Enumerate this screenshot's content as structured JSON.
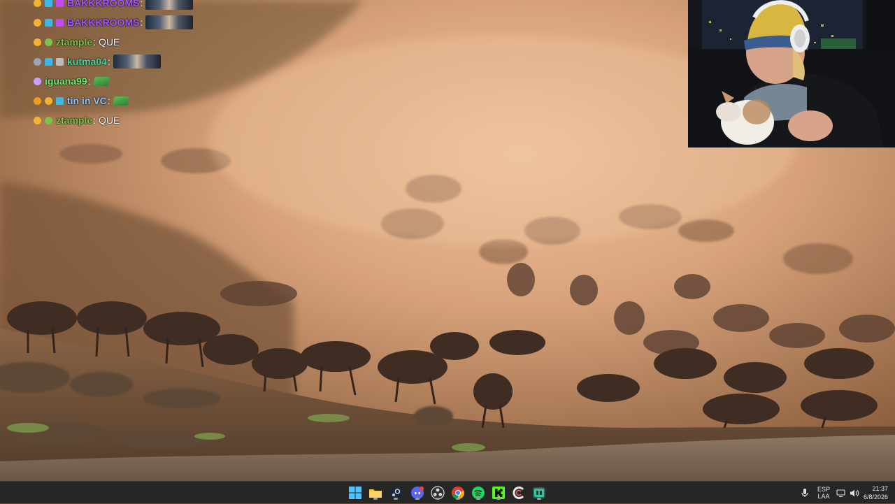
{
  "chat": {
    "messages": [
      {
        "user": "BAKKKROOMS",
        "color": "#a259ff",
        "badges": [
          "#f2b233",
          "#3fb6e8",
          "#c04cf0"
        ],
        "text": "",
        "emote": "image"
      },
      {
        "user": "BAKKKROOMS",
        "color": "#a259ff",
        "badges": [
          "#f2b233",
          "#3fb6e8",
          "#c04cf0"
        ],
        "text": "",
        "emote": "image"
      },
      {
        "user": "ztample",
        "color": "#7cc24a",
        "badges": [
          "#f2b233",
          "#7cc24a"
        ],
        "text": "QUE",
        "emote": ""
      },
      {
        "user": "kutma04",
        "color": "#4fd6a0",
        "badges": [
          "#9aa6b4",
          "#3fb6e8",
          "#bcbcbc"
        ],
        "text": "",
        "emote": "image"
      },
      {
        "user": "iguana99",
        "color": "#6ee86e",
        "badges": [
          "#c9a2ff"
        ],
        "text": "",
        "emote": "green"
      },
      {
        "user": "tin in VC",
        "color": "#8fc8ff",
        "badges": [
          "#f29c1f",
          "#f2b233",
          "#3fb6e8"
        ],
        "text": "",
        "emote": "green"
      },
      {
        "user": "ztample",
        "color": "#7cc24a",
        "badges": [
          "#f2b233",
          "#7cc24a"
        ],
        "text": "QUE",
        "emote": ""
      }
    ]
  },
  "taskbar": {
    "apps": [
      {
        "name": "windows-start-icon"
      },
      {
        "name": "file-explorer-icon"
      },
      {
        "name": "steam-icon"
      },
      {
        "name": "discord-icon"
      },
      {
        "name": "obs-icon"
      },
      {
        "name": "chrome-icon"
      },
      {
        "name": "spotify-icon"
      },
      {
        "name": "kick-icon"
      },
      {
        "name": "ccleaner-icon"
      },
      {
        "name": "streamlabs-icon"
      }
    ],
    "tray": {
      "language_top": "ESP",
      "language_bottom": "LAA",
      "time": "21:37",
      "date": "6/8/2026"
    }
  },
  "colors": {
    "taskbar_bg": "#262624",
    "dust": "#d7a27a",
    "water": "#7e6a58"
  }
}
